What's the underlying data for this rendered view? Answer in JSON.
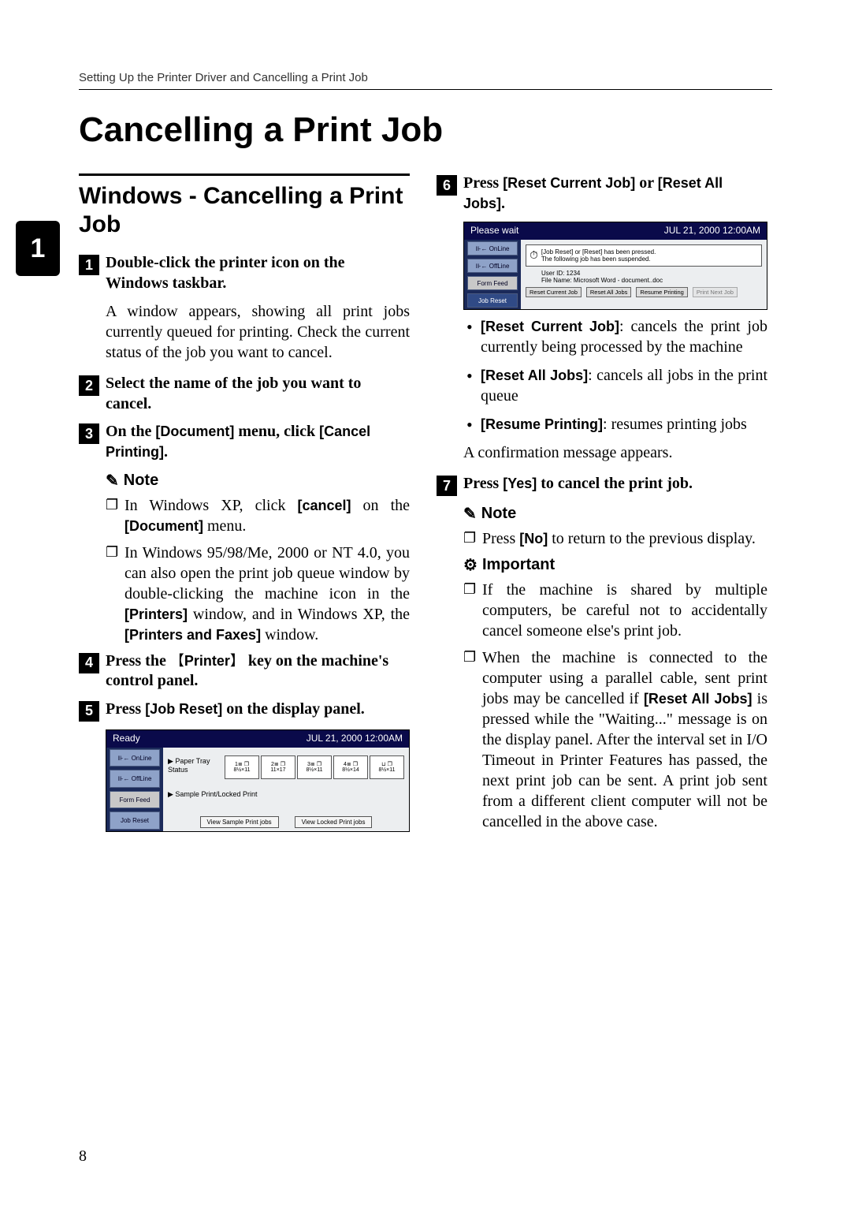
{
  "running_head": "Setting Up the Printer Driver and Cancelling a Print Job",
  "page_number": "8",
  "side_tab": "1",
  "title": "Cancelling a Print Job",
  "left": {
    "section_title": "Windows - Cancelling a Print Job",
    "steps": {
      "s1": {
        "num": "1",
        "text_a": "Double-click the printer icon on the Windows taskbar.",
        "para": "A window appears, showing all print jobs currently queued for printing. Check the current status of the job you want to cancel."
      },
      "s2": {
        "num": "2",
        "text_a": "Select the name of the job you want to cancel."
      },
      "s3": {
        "num": "3",
        "pre": "On the ",
        "ui1": "[Document]",
        "mid": " menu, click ",
        "ui2": "[Cancel Printing]",
        "post": "."
      },
      "note_label": "Note",
      "note_items": {
        "n1": {
          "pre": "In Windows XP, click ",
          "ui": "[cancel]",
          "mid": " on the ",
          "ui2": "[Document]",
          "post": " menu."
        },
        "n2": {
          "pre": "In Windows 95/98/Me, 2000 or NT 4.0, you can also open the print job queue window by double-clicking the machine icon in the ",
          "ui": "[Printers]",
          "mid": " window, and in Windows XP, the ",
          "ui2": "[Printers and Faxes]",
          "post": " window."
        }
      },
      "s4": {
        "num": "4",
        "pre": "Press the ",
        "key_open": "【",
        "key": "Printer",
        "key_close": "】",
        "post": " key on the machine's control panel."
      },
      "s5": {
        "num": "5",
        "pre": "Press ",
        "ui": "[Job Reset]",
        "post": " on the display panel."
      }
    },
    "screenshot1": {
      "topbar_left": "Ready",
      "date": "JUL   21, 2000 12:00AM",
      "sidebar": [
        "⊪← OnLine",
        "⊪← OffLine",
        "Form Feed",
        "Job Reset"
      ],
      "paper_label": "▶ Paper Tray Status",
      "trays": [
        {
          "t": "1≣ ❐",
          "p": "8½×11"
        },
        {
          "t": "2≣ ❐",
          "p": "11×17"
        },
        {
          "t": "3≣ ❐",
          "p": "8½×11"
        },
        {
          "t": "4≣ ❐",
          "p": "8½×14"
        },
        {
          "t": "⊔ ❐",
          "p": "8½×11"
        }
      ],
      "sample_label": "▶ Sample Print/Locked Print",
      "link1": "View Sample Print jobs",
      "link2": "View Locked Print jobs"
    }
  },
  "right": {
    "s6": {
      "num": "6",
      "pre": "Press ",
      "ui1": "[Reset Current Job]",
      "mid": " or ",
      "ui2": "[Reset All Jobs]",
      "post": "."
    },
    "screenshot2": {
      "topbar_left": "Please wait",
      "date": "JUL   21, 2000 12:00AM",
      "sidebar": [
        "⊪← OnLine",
        "⊪← OffLine",
        "Form Feed",
        "Job Reset"
      ],
      "dlg_l1": "[Job Reset] or [Reset] has been pressed.",
      "dlg_l2": "The following job has been suspended.",
      "user": "User ID: 1234",
      "file": "File Name: Microsoft Word - document..doc",
      "btns": [
        "Reset Current Job",
        "Reset All Jobs",
        "Resume Printing",
        "Print Next Job"
      ]
    },
    "bullets": {
      "b1": {
        "ui": "[Reset Current Job]",
        "rest": ": cancels the print job currently being processed by the machine"
      },
      "b2": {
        "ui": "[Reset All Jobs]",
        "rest": ": cancels all jobs in the print queue"
      },
      "b3": {
        "ui": "[Resume Printing]",
        "rest": ": resumes printing jobs"
      }
    },
    "confirm_para": "A confirmation message appears.",
    "s7": {
      "num": "7",
      "pre": "Press ",
      "ui": "[Yes]",
      "post": " to cancel the print job."
    },
    "note_label": "Note",
    "note_item": {
      "pre": "Press ",
      "ui": "[No]",
      "post": " to return to the previous display."
    },
    "important_label": "Important",
    "imp_items": {
      "i1": "If the machine is shared by multiple computers, be careful not to accidentally cancel someone else's print job.",
      "i2": {
        "pre": "When the machine is connected to the computer using a parallel cable, sent print jobs may be cancelled if ",
        "ui": "[Reset All Jobs]",
        "post": " is pressed while the \"Waiting...\" message is on the display panel. After the interval set in I/O Timeout in Printer Features has passed, the next print job can be sent. A print job sent from a different client computer will not be cancelled in the above case."
      }
    }
  }
}
